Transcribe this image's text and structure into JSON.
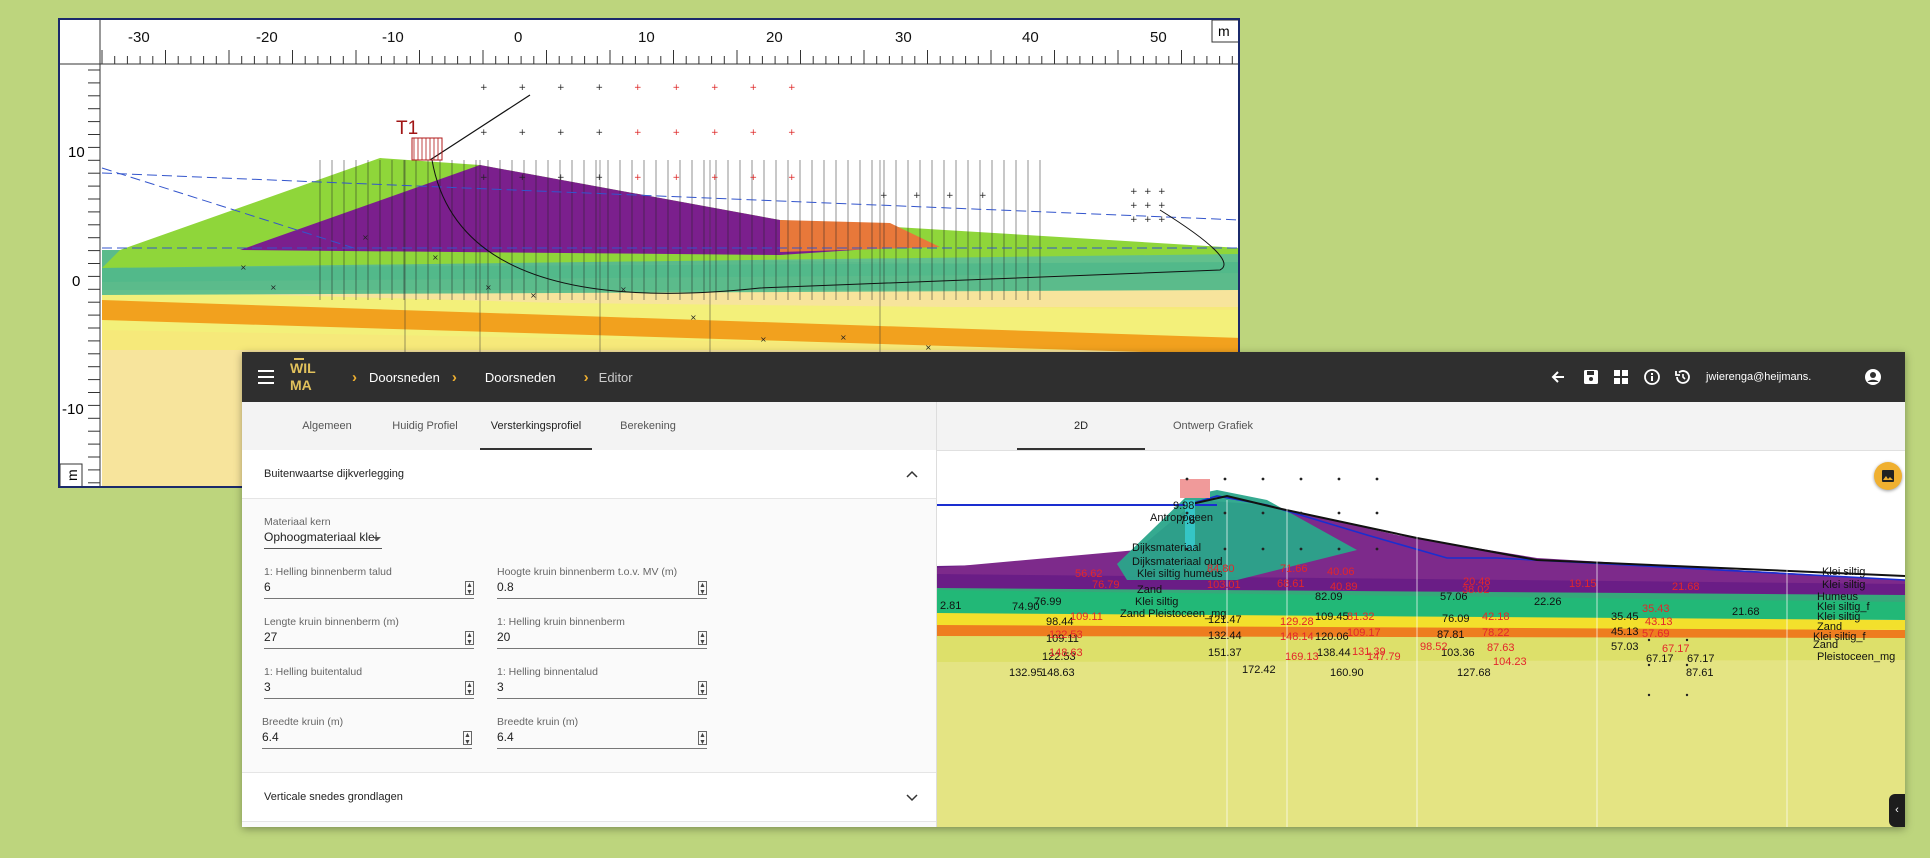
{
  "cad": {
    "x_ticks": [
      "-30",
      "-20",
      "-10",
      "0",
      "10",
      "20",
      "30",
      "40",
      "50"
    ],
    "unit_x": "m",
    "y_ticks": [
      "10",
      "0",
      "-10"
    ],
    "unit_y": "m",
    "marker_label": "T1"
  },
  "app": {
    "logo_line1": "WIL",
    "logo_line2": "MA",
    "breadcrumb": [
      {
        "label": "Doorsneden"
      },
      {
        "label": "Doorsneden"
      },
      {
        "label": "Editor"
      }
    ],
    "user": "jwierenga@heijmans."
  },
  "left_tabs": [
    {
      "label": "Algemeen"
    },
    {
      "label": "Huidig Profiel"
    },
    {
      "label": "Versterkingsprofiel"
    },
    {
      "label": "Berekening"
    }
  ],
  "section1": {
    "title": "Buitenwaartse dijkverlegging"
  },
  "material": {
    "label": "Materiaal kern",
    "value": "Ophoogmateriaal klei"
  },
  "fields": [
    {
      "label": "1: Helling binnenberm talud",
      "value": "6"
    },
    {
      "label": "Hoogte kruin binnenberm t.o.v. MV (m)",
      "value": "0.8"
    },
    {
      "label": "Lengte kruin binnenberm (m)",
      "value": "27"
    },
    {
      "label": "1: Helling kruin binnenberm",
      "value": "20"
    },
    {
      "label": "1: Helling buitentalud",
      "value": "3"
    },
    {
      "label": "1: Helling binnentalud",
      "value": "3"
    },
    {
      "label": "Breedte kruin (m)",
      "value": "6.4"
    },
    {
      "label": "Breedte kruin (m)",
      "value": "6.4"
    }
  ],
  "section2": {
    "title": "Verticale snedes grondlagen"
  },
  "right_tabs": [
    {
      "label": "2D"
    },
    {
      "label": "Ontwerp Grafiek"
    }
  ],
  "plot_labels": {
    "black": [
      "9.98",
      "7.6",
      "Antropogeen",
      "Dijksmateriaal",
      "Dijksmateriaal oud",
      "Klei siltig humeus",
      "Zand",
      "Klei siltig",
      "Zand Pleistoceen_mg",
      "Klei siltig",
      "Klei siltig",
      "Humeus",
      "Klei siltig_f",
      "Klei siltig",
      "Zand",
      "Klei siltig_f",
      "Zand",
      "Pleistoceen_mg",
      "74.90",
      "76.99",
      "98.44",
      "109.11",
      "122.53",
      "132.95",
      "148.63",
      "2.81",
      "121.47",
      "132.44",
      "151.37",
      "172.42",
      "82.09",
      "109.45",
      "120.06",
      "138.44",
      "160.90",
      "57.06",
      "76.09",
      "87.81",
      "103.36",
      "127.68",
      "22.26",
      "35.45",
      "45.13",
      "57.03",
      "67.17",
      "87.61",
      "21.68",
      "67.17"
    ],
    "red": [
      "56.62",
      "76.79",
      "84.80",
      "103.01",
      "71.66",
      "68.61",
      "40.06",
      "40.89",
      "20.48",
      "38.02",
      "19.15",
      "21.68",
      "109.11",
      "122.53",
      "148.63",
      "129.28",
      "148.14",
      "169.13",
      "81.32",
      "109.17",
      "131.39",
      "98.52",
      "147.79",
      "78.22",
      "87.63",
      "104.23",
      "42.18",
      "57.69",
      "35.43",
      "43.13",
      "67.17"
    ]
  },
  "colors": {
    "accent": "#f0b030",
    "topbar": "#2f2f2f",
    "background": "#bdd57d"
  }
}
